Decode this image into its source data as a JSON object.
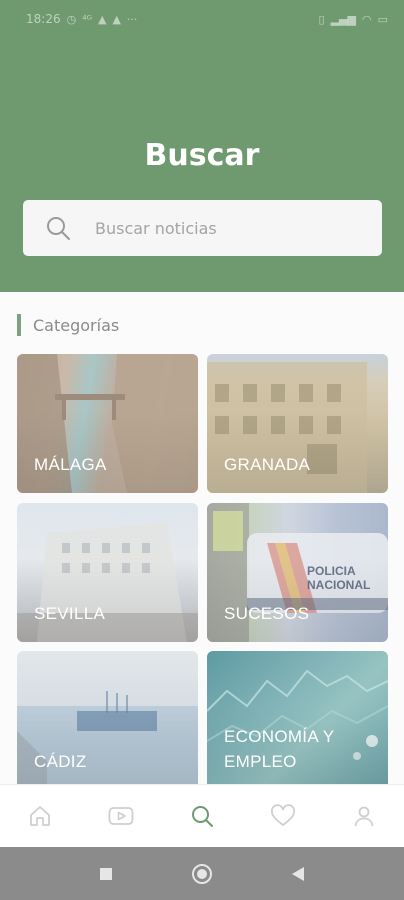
{
  "status_bar": {
    "time": "18:26",
    "icons": [
      "alarm-icon",
      "4g-icon",
      "notification-icon",
      "notification-icon",
      "more-dots-icon",
      "vibrate-icon",
      "signal-icon",
      "wifi-icon",
      "battery-icon"
    ]
  },
  "header": {
    "title": "Buscar",
    "background_color": "#6f9a6f"
  },
  "search": {
    "placeholder": "Buscar noticias",
    "value": "",
    "icon": "search-icon"
  },
  "categories": {
    "section_title": "Categorías",
    "accent_color": "#7da27d",
    "items": [
      {
        "label": "MÁLAGA"
      },
      {
        "label": "GRANADA"
      },
      {
        "label": "SEVILLA"
      },
      {
        "label": "SUCESOS"
      },
      {
        "label": "CÁDIZ"
      },
      {
        "label": "ECONOMÍA Y EMPLEO"
      }
    ],
    "sucesos_car_text": "POLICIA NACIONAL"
  },
  "bottom_nav": {
    "items": [
      {
        "icon": "home-icon",
        "active": false
      },
      {
        "icon": "video-play-icon",
        "active": false
      },
      {
        "icon": "search-icon",
        "active": true
      },
      {
        "icon": "heart-icon",
        "active": false
      },
      {
        "icon": "user-icon",
        "active": false
      }
    ],
    "active_color": "#6f9a6f",
    "inactive_color": "#cfcfcf"
  },
  "system_nav": {
    "items": [
      "recent-apps-icon",
      "home-circle-icon",
      "back-icon"
    ]
  }
}
